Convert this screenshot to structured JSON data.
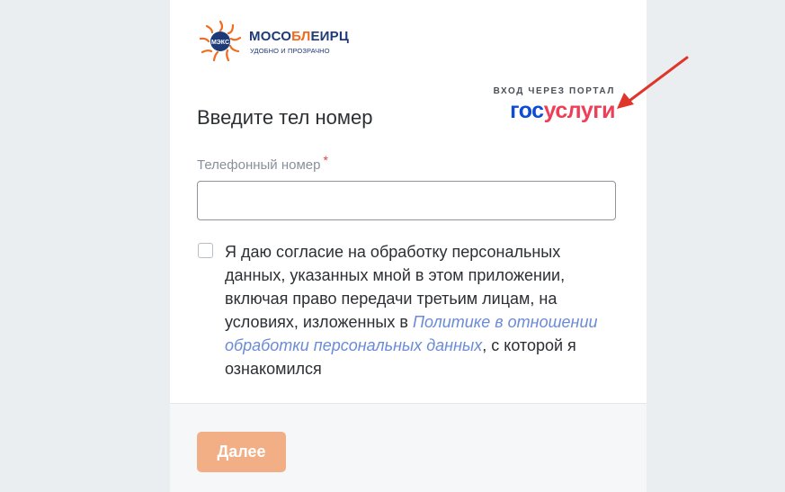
{
  "brand": {
    "name_part1": "МОСО",
    "name_part2": "БЛ",
    "name_part3": "ЕИРЦ",
    "tagline": "УДОБНО И ПРОЗРАЧНО",
    "emblem_text": "МЭКС"
  },
  "form": {
    "title": "Введите тел номер",
    "phone_label": "Телефонный номер",
    "required_mark": "*",
    "phone_value": "",
    "consent_text_before": "Я даю согласие на обработку персональных данных, указанных мной в этом приложении, включая право передачи третьим лицам, на условиях, изложенных в ",
    "consent_link": "Политике в отношении обработки персональных данных",
    "consent_text_after": ", с которой я ознакомился",
    "consent_checked": false,
    "submit_label": "Далее"
  },
  "gosuslugi": {
    "caption": "ВХОД ЧЕРЕЗ ПОРТАЛ",
    "logo_part1": "гос",
    "logo_part2": "услуги"
  },
  "colors": {
    "accent_orange": "#f26a1b",
    "brand_blue": "#1e3a78",
    "button_bg": "#f2ae85",
    "gos_blue": "#0d4cd3",
    "gos_red": "#ee3f58",
    "arrow_red": "#e0352b",
    "link": "#6a8bd6"
  },
  "icons": [
    "sun-logo-icon",
    "red-arrow-icon"
  ]
}
